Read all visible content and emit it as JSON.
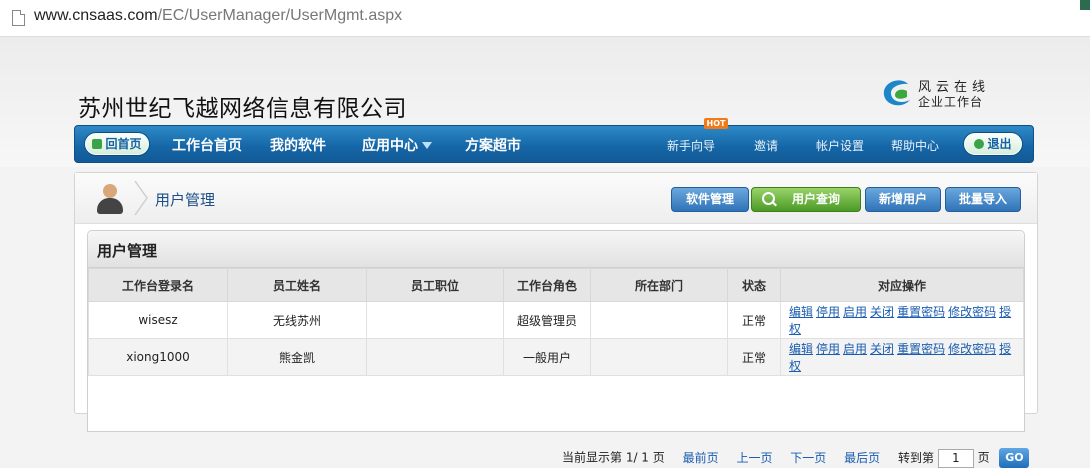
{
  "browser": {
    "url_host": "www.cnsaas.com",
    "url_path": "/EC/UserManager/UserMgmt.aspx"
  },
  "header": {
    "company_name": "苏州世纪飞越网络信息有限公司",
    "logo_line1": "风云在线",
    "logo_line2": "企业工作台"
  },
  "nav": {
    "home": "回首页",
    "items": [
      "工作台首页",
      "我的软件",
      "应用中心",
      "方案超市"
    ],
    "secondary": [
      "新手向导",
      "邀请",
      "帐户设置",
      "帮助中心"
    ],
    "hot_badge": "HOT",
    "logout": "退出"
  },
  "page": {
    "breadcrumb": "用户管理",
    "toolbar": [
      "软件管理",
      "用户查询",
      "新增用户",
      "批量导入"
    ],
    "section_title": "用户管理"
  },
  "table": {
    "columns": [
      "工作台登录名",
      "员工姓名",
      "员工职位",
      "工作台角色",
      "所在部门",
      "状态",
      "对应操作"
    ],
    "rows": [
      {
        "login": "wisesz",
        "name": "无线苏州",
        "position": "",
        "role": "超级管理员",
        "dept": "",
        "status": "正常"
      },
      {
        "login": "xiong1000",
        "name": "熊金凯",
        "position": "",
        "role": "一般用户",
        "dept": "",
        "status": "正常"
      }
    ],
    "actions": [
      "编辑",
      "停用",
      "启用",
      "关闭",
      "重置密码",
      "修改密码",
      "授权"
    ]
  },
  "pager": {
    "current_text": "当前显示第 1/ 1 页",
    "first": "最前页",
    "prev": "上一页",
    "next": "下一页",
    "last": "最后页",
    "goto_label": "转到第",
    "page_value": "1",
    "page_unit": "页",
    "go": "GO"
  },
  "colors": {
    "nav_blue": "#1565a6",
    "link_blue": "#1a5cb0",
    "green_button": "#4b9a25",
    "hot_orange": "#f07a18"
  }
}
